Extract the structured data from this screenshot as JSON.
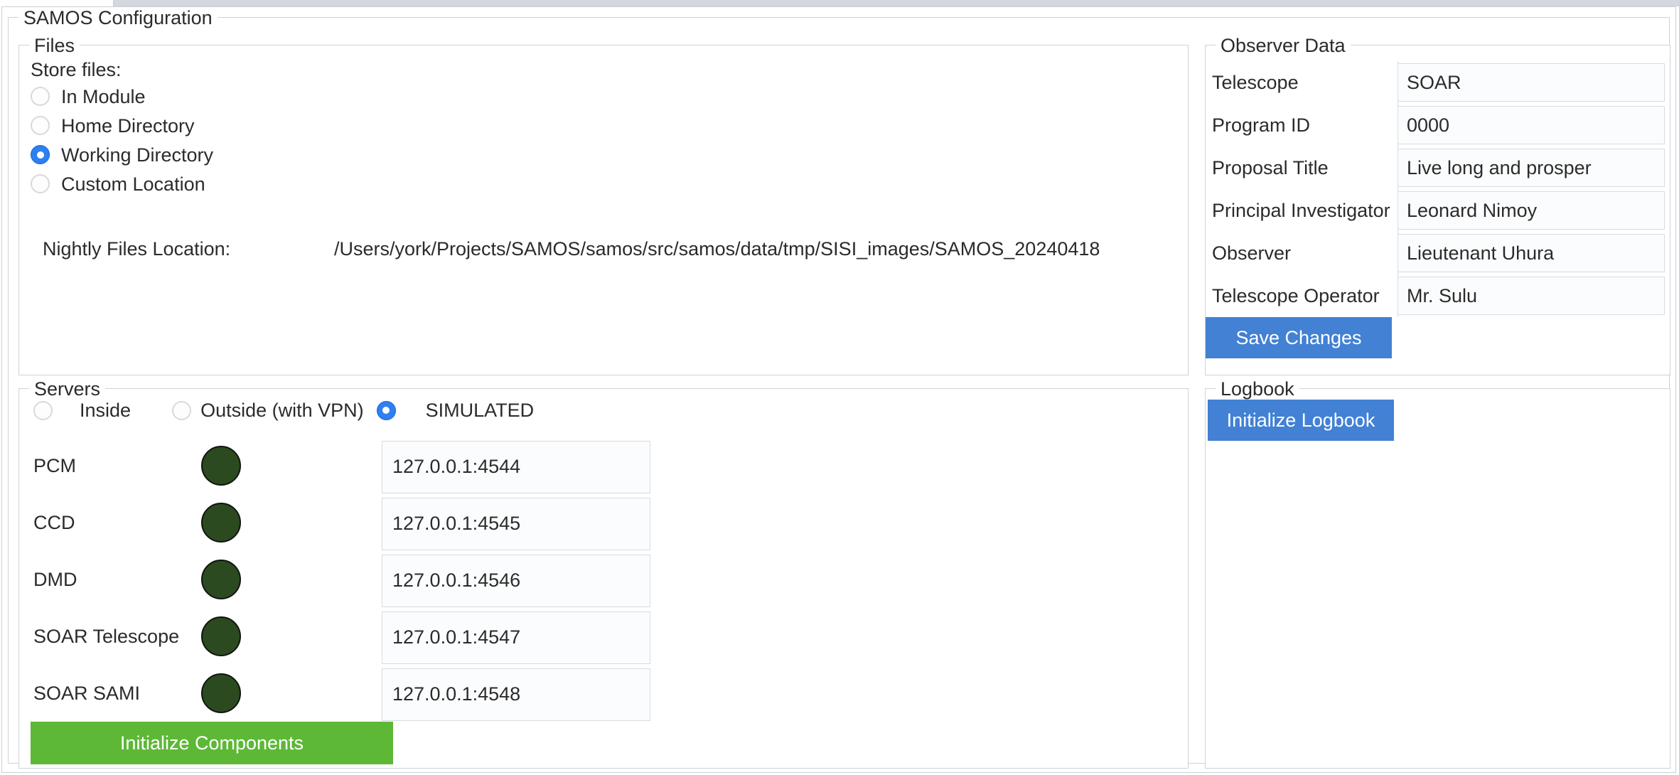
{
  "window": {
    "group_title": "SAMOS Configuration"
  },
  "files": {
    "title": "Files",
    "store_files_label": "Store files:",
    "options": [
      {
        "label": "In Module",
        "selected": false
      },
      {
        "label": "Home Directory",
        "selected": false
      },
      {
        "label": "Working Directory",
        "selected": true
      },
      {
        "label": "Custom Location",
        "selected": false
      }
    ],
    "nightly_label": "Nightly Files Location:",
    "nightly_value": "/Users/york/Projects/SAMOS/samos/src/samos/data/tmp/SISI_images/SAMOS_20240418"
  },
  "observer": {
    "title": "Observer Data",
    "fields": [
      {
        "label": "Telescope",
        "value": "SOAR"
      },
      {
        "label": "Program ID",
        "value": "0000"
      },
      {
        "label": "Proposal Title",
        "value": "Live long and prosper"
      },
      {
        "label": "Principal Investigator",
        "value": "Leonard Nimoy"
      },
      {
        "label": "Observer",
        "value": "Lieutenant Uhura"
      },
      {
        "label": "Telescope Operator",
        "value": "Mr. Sulu"
      }
    ],
    "save_label": "Save Changes"
  },
  "servers": {
    "title": "Servers",
    "modes": [
      {
        "label": "Inside",
        "selected": false
      },
      {
        "label": "Outside (with VPN)",
        "selected": false
      },
      {
        "label": "SIMULATED",
        "selected": true
      }
    ],
    "rows": [
      {
        "name": "PCM",
        "status_color": "#2c4a20",
        "address": "127.0.0.1:4544"
      },
      {
        "name": "CCD",
        "status_color": "#2c4a20",
        "address": "127.0.0.1:4545"
      },
      {
        "name": "DMD",
        "status_color": "#2c4a20",
        "address": "127.0.0.1:4546"
      },
      {
        "name": "SOAR Telescope",
        "status_color": "#2c4a20",
        "address": "127.0.0.1:4547"
      },
      {
        "name": "SOAR SAMI",
        "status_color": "#2c4a20",
        "address": "127.0.0.1:4548"
      }
    ],
    "init_label": "Initialize Components"
  },
  "logbook": {
    "title": "Logbook",
    "init_label": "Initialize Logbook"
  },
  "colors": {
    "accent_blue": "#4281d4",
    "accent_green": "#5db836",
    "radio_blue": "#2f7ff0",
    "led_dark_green": "#2c4a20"
  }
}
